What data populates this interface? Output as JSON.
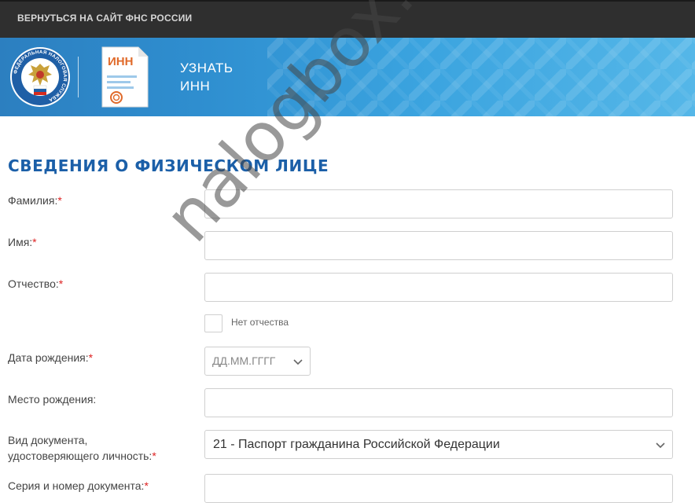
{
  "topbar": {
    "back_link": "ВЕРНУТЬСЯ НА САЙТ ФНС РОССИИ"
  },
  "banner": {
    "emblem_ring_text": "ФЕДЕРАЛЬНАЯ НАЛОГОВАЯ СЛУЖБА",
    "doc_icon_text": "ИНН",
    "title_line1": "УЗНАТЬ",
    "title_line2": "ИНН"
  },
  "watermark": "nalogbox.ru",
  "form": {
    "section_title": "СВЕДЕНИЯ О ФИЗИЧЕСКОМ ЛИЦЕ",
    "required_mark": "*",
    "fields": {
      "surname_label": "Фамилия:",
      "name_label": "Имя:",
      "patronymic_label": "Отчество:",
      "no_patronymic_label": "Нет отчества",
      "birthdate_label": "Дата рождения:",
      "birthdate_placeholder": "ДД.ММ.ГГГГ",
      "birthplace_label": "Место рождения:",
      "doc_type_label_line1": "Вид документа,",
      "doc_type_label_line2": "удостоверяющего личность:",
      "doc_type_value": "21 - Паспорт гражданина Российской Федерации",
      "doc_number_label": "Серия и номер документа:"
    }
  },
  "colors": {
    "topbar": "#2f2f2f",
    "banner_blue": "#2f8fd0",
    "title_blue": "#1b5fa8",
    "required_red": "#dd2222"
  }
}
